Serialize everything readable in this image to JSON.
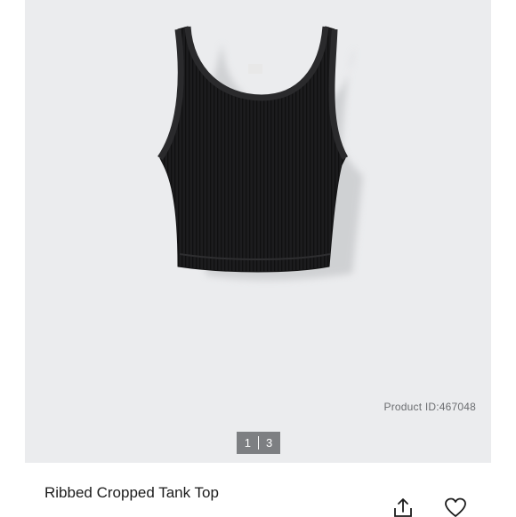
{
  "product": {
    "id_label": "Product ID:467048",
    "title": "Ribbed Cropped Tank Top",
    "image_alt": "Black ribbed cropped tank top"
  },
  "gallery": {
    "current": "1",
    "total": "3"
  },
  "icons": {
    "share": "share-icon",
    "favorite": "heart-icon"
  },
  "colors": {
    "photo_background": "#ebecee",
    "garment": "#1c1c1e",
    "pager_background": "#7d7f82"
  }
}
